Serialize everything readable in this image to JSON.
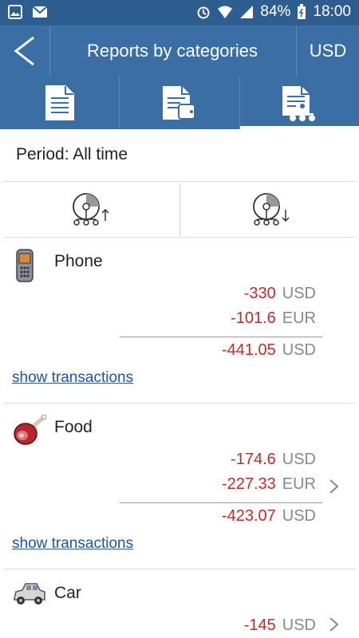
{
  "status_bar": {
    "battery": "84%",
    "time": "18:00"
  },
  "app_bar": {
    "title": "Reports by categories",
    "currency": "USD"
  },
  "tabs": [
    {
      "name": "report-list",
      "active": false
    },
    {
      "name": "report-wallet",
      "active": false
    },
    {
      "name": "report-categories",
      "active": true
    }
  ],
  "period": {
    "label": "Period: All time"
  },
  "categories": [
    {
      "name": "Phone",
      "icon": "phone-icon",
      "amounts": [
        {
          "value": "-330",
          "currency": "USD"
        },
        {
          "value": "-101.6",
          "currency": "EUR"
        }
      ],
      "total": {
        "value": "-441.05",
        "currency": "USD"
      },
      "link": "show transactions"
    },
    {
      "name": "Food",
      "icon": "ham-icon",
      "amounts": [
        {
          "value": "-174.6",
          "currency": "USD"
        },
        {
          "value": "-227.33",
          "currency": "EUR"
        }
      ],
      "total": {
        "value": "-423.07",
        "currency": "USD"
      },
      "link": "show transactions"
    },
    {
      "name": "Car",
      "icon": "car-icon",
      "amounts": [
        {
          "value": "-145",
          "currency": "USD"
        }
      ]
    }
  ],
  "colors": {
    "header": "#3a6ea5",
    "statusbar": "#2e5d8f",
    "negative": "#c62828",
    "link": "#1a56a0"
  }
}
